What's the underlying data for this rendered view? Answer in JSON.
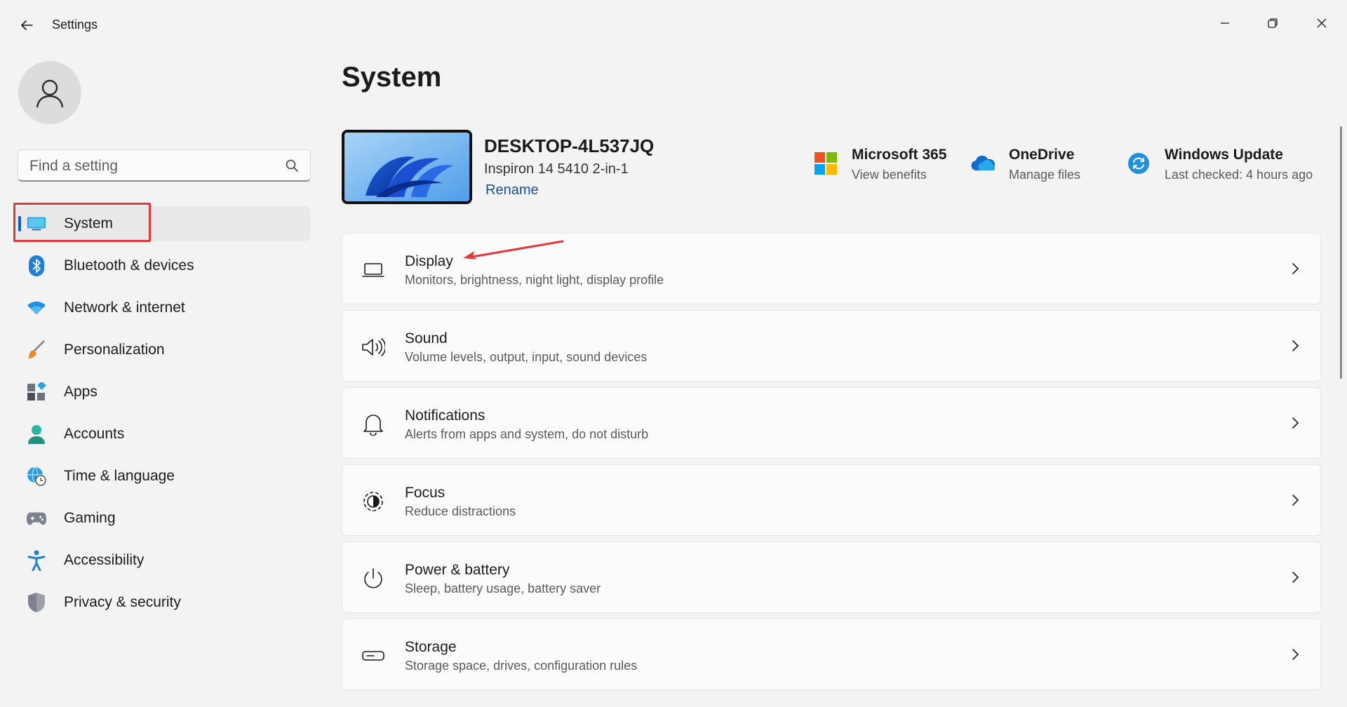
{
  "window": {
    "title": "Settings",
    "back_icon": "back-arrow-icon",
    "controls": [
      "minimize-icon",
      "restore-icon",
      "close-icon"
    ]
  },
  "sidebar": {
    "avatar_icon": "user-icon",
    "search": {
      "placeholder": "Find a setting",
      "value": ""
    },
    "items": [
      {
        "label": "System",
        "icon": "monitor-icon",
        "active": true
      },
      {
        "label": "Bluetooth & devices",
        "icon": "bluetooth-icon"
      },
      {
        "label": "Network & internet",
        "icon": "wifi-icon"
      },
      {
        "label": "Personalization",
        "icon": "brush-icon"
      },
      {
        "label": "Apps",
        "icon": "apps-icon"
      },
      {
        "label": "Accounts",
        "icon": "account-icon"
      },
      {
        "label": "Time & language",
        "icon": "globe-clock-icon"
      },
      {
        "label": "Gaming",
        "icon": "gamepad-icon"
      },
      {
        "label": "Accessibility",
        "icon": "accessibility-icon"
      },
      {
        "label": "Privacy & security",
        "icon": "shield-icon"
      }
    ]
  },
  "main": {
    "title": "System",
    "device": {
      "name": "DESKTOP-4L537JQ",
      "model": "Inspiron 14 5410 2-in-1",
      "rename_label": "Rename"
    },
    "quick_links": [
      {
        "title": "Microsoft 365",
        "subtitle": "View benefits",
        "icon": "microsoft-logo-icon"
      },
      {
        "title": "OneDrive",
        "subtitle": "Manage files",
        "icon": "cloud-icon"
      },
      {
        "title": "Windows Update",
        "subtitle": "Last checked: 4 hours ago",
        "icon": "sync-icon"
      }
    ],
    "cards": [
      {
        "title": "Display",
        "subtitle": "Monitors, brightness, night light, display profile",
        "icon": "laptop-icon"
      },
      {
        "title": "Sound",
        "subtitle": "Volume levels, output, input, sound devices",
        "icon": "speaker-icon"
      },
      {
        "title": "Notifications",
        "subtitle": "Alerts from apps and system, do not disturb",
        "icon": "bell-icon"
      },
      {
        "title": "Focus",
        "subtitle": "Reduce distractions",
        "icon": "focus-icon"
      },
      {
        "title": "Power & battery",
        "subtitle": "Sleep, battery usage, battery saver",
        "icon": "power-icon"
      },
      {
        "title": "Storage",
        "subtitle": "Storage space, drives, configuration rules",
        "icon": "storage-icon"
      }
    ]
  },
  "colors": {
    "accent": "#0067c0",
    "annotation": "#e0393e",
    "background": "#f3f3f3",
    "card": "#fbfbfb"
  }
}
